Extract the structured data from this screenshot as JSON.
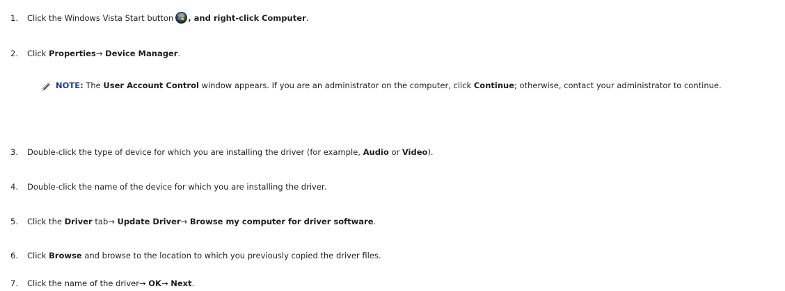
{
  "steps": [
    {
      "num": "1.",
      "t1": "Click the Windows Vista Start button",
      "t2": ", and right-click",
      "b1": "Computer",
      "t3": "."
    },
    {
      "num": "2.",
      "t1": "Click",
      "b1": "Properties",
      "arrow1": "→",
      "b2": "Device Manager",
      "t2": "."
    },
    {
      "num": "3.",
      "t1": "Double-click the type of device for which you are installing the driver (for example,",
      "b1": "Audio",
      "t2": "or",
      "b2": "Video",
      "t3": ")."
    },
    {
      "num": "4.",
      "t1": "Double-click the name of the device for which you are installing the driver."
    },
    {
      "num": "5.",
      "t1": "Click the",
      "b1": "Driver",
      "t2": "tab",
      "arrow1": "→",
      "b2": "Update Driver",
      "arrow2": "→",
      "b3": "Browse my computer for driver software",
      "t3": "."
    },
    {
      "num": "6.",
      "t1": "Click",
      "b1": "Browse",
      "t2": "and browse to the location to which you previously copied the driver files."
    },
    {
      "num": "7.",
      "t1": "Click the name of the driver",
      "arrow1": "→",
      "b1": "OK",
      "arrow2": "→",
      "b2": "Next",
      "t2": "."
    }
  ],
  "note": {
    "label": "NOTE:",
    "t1": "The",
    "b1": "User Account Control",
    "t2": "window appears. If you are an administrator on the computer, click",
    "b2": "Continue",
    "t3": "; otherwise, contact your administrator to continue.",
    "icon": "pencil-icon"
  },
  "colors": {
    "note_label": "#1d3f8a",
    "text": "#1f1f1f"
  }
}
